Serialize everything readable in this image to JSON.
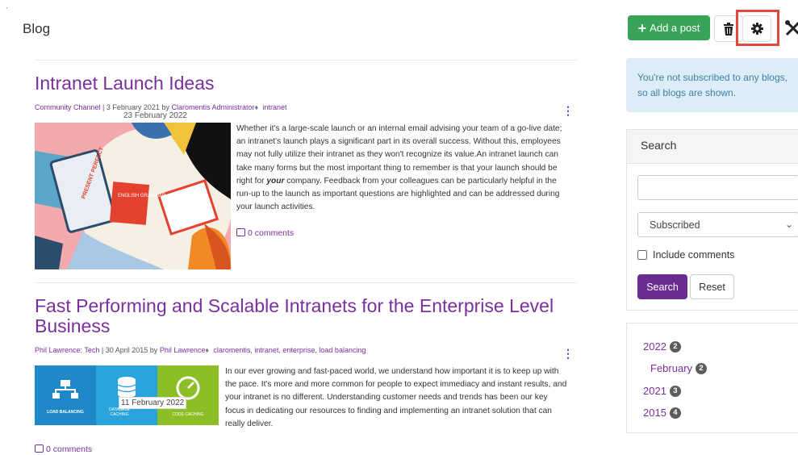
{
  "page": {
    "title": "Blog",
    "corner_mark": "'"
  },
  "toolbar": {
    "add_post_label": "Add a post",
    "add_icon": "plus-icon",
    "delete_icon": "trash-icon",
    "settings_icon": "gear-icon",
    "tools_icon": "tools-icon"
  },
  "posts": [
    {
      "title": "Intranet Launch Ideas",
      "channel": "Community Channel",
      "date": "3 February 2021",
      "by": "by",
      "author": "Claromentis Administrator",
      "tags": "intranet",
      "image_date": "23 February 2022",
      "excerpt_before": "Whether it's a large-scale launch or an internal email advising your team of a go-live date; an intranet's launch plays a significant part in its overall success. Without this, employees may not fully utilize their intranet as they won't recognize its value.An intranet launch can take many forms but the most important thing to remember is that your launch should be right for ",
      "excerpt_emphasis": "your",
      "excerpt_after": " company. Feedback from your colleagues can be particularly helpful in the run-up to the launch as important questions are highlighted and can be addressed during your launch activities.",
      "comments": "0 comments",
      "image_texts": {
        "book": "PRESENT PERFECT",
        "grammar": "ENGLISH GRAMMAR"
      }
    },
    {
      "title": "Fast Performing and Scalable Intranets for the Enterprise Level Business",
      "channel": "Phil Lawrence: Tech",
      "date": "30 April 2015",
      "by": "by",
      "author": "Phil Lawrence",
      "tags": "claromentis, intranet, enterprise, load balancing",
      "image_date": "11 February 2022",
      "excerpt": "In our ever growing and fast-paced world, we understand how important it is to keep up with the pace. It's more and more common for people to expect immediacy and instant results, and your intranet is no different. Understanding customer needs and trends has been our key focus in dedicating our resources to finding and implementing an intranet solution that can really deliver.",
      "comments": "0 comments",
      "image_panels": [
        {
          "label": "LOAD BALANCING",
          "color": "#1e88c8"
        },
        {
          "label": "DATABASE CACHING",
          "color": "#29a3dc"
        },
        {
          "label": "CODE CACHING",
          "color": "#8cbf26"
        }
      ]
    }
  ],
  "sidebar": {
    "info": "You're not subscribed to any blogs, so all blogs are shown.",
    "search": {
      "heading": "Search",
      "input_value": "",
      "filter_value": "Subscribed",
      "include_comments": "Include comments",
      "search_button": "Search",
      "reset_button": "Reset"
    },
    "archive": [
      {
        "label": "2022",
        "count": "2"
      },
      {
        "label": "February",
        "count": "2"
      },
      {
        "label": "2021",
        "count": "3"
      },
      {
        "label": "2015",
        "count": "4"
      }
    ]
  },
  "colors": {
    "accent": "#7a2f9e",
    "add": "#3aa35a",
    "search": "#6b2c91",
    "highlight": "#e2483e"
  }
}
